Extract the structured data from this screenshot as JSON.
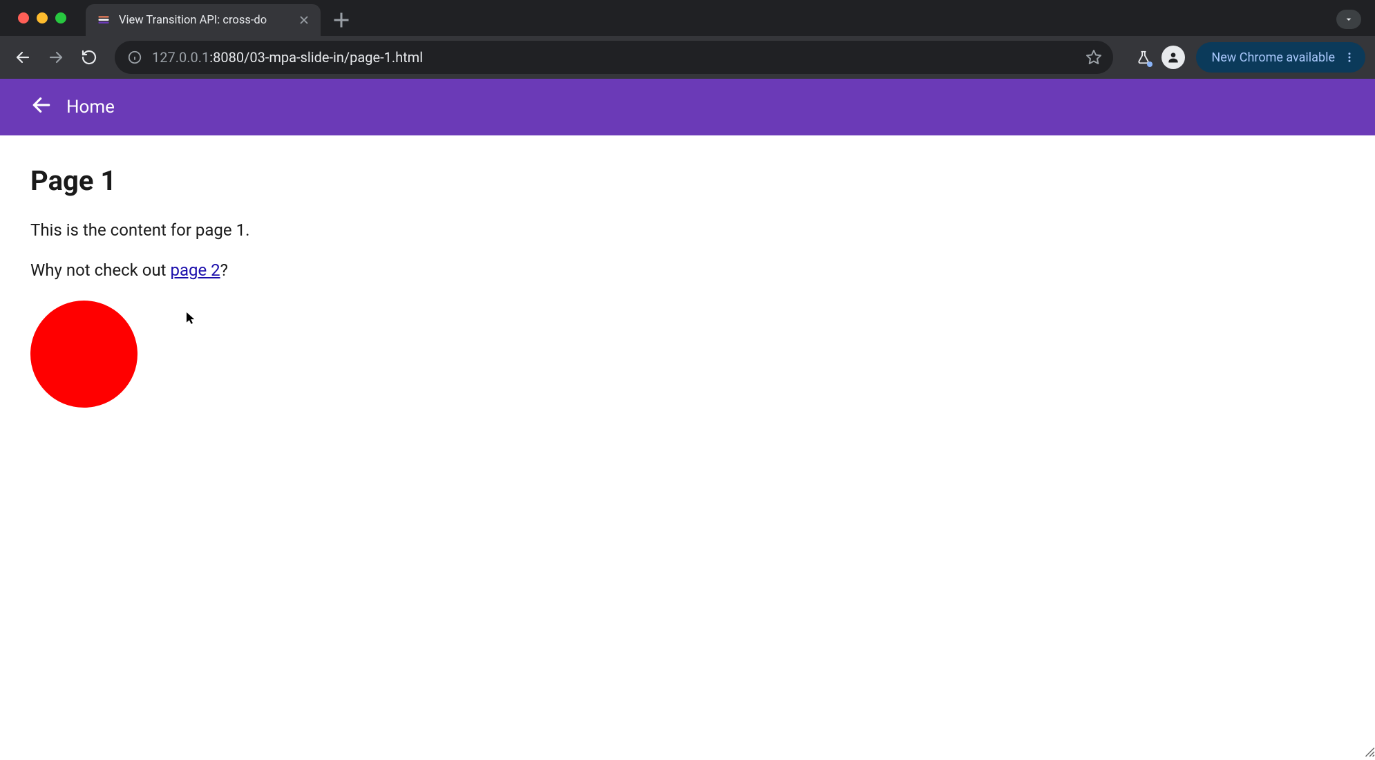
{
  "browser": {
    "tab": {
      "title": "View Transition API: cross-do",
      "favicon_name": "layers-icon"
    },
    "url": {
      "host": "127.0.0.1",
      "port": ":8080",
      "path": "/03-mpa-slide-in/page-1.html"
    },
    "update_pill_label": "New Chrome available"
  },
  "page": {
    "header": {
      "back_label": "Home"
    },
    "title": "Page 1",
    "paragraph1": "This is the content for page 1.",
    "paragraph2_prefix": "Why not check out ",
    "paragraph2_link": "page 2",
    "paragraph2_suffix": "?",
    "circle_color": "#ff0000",
    "accent_color": "#6b3ab7"
  }
}
